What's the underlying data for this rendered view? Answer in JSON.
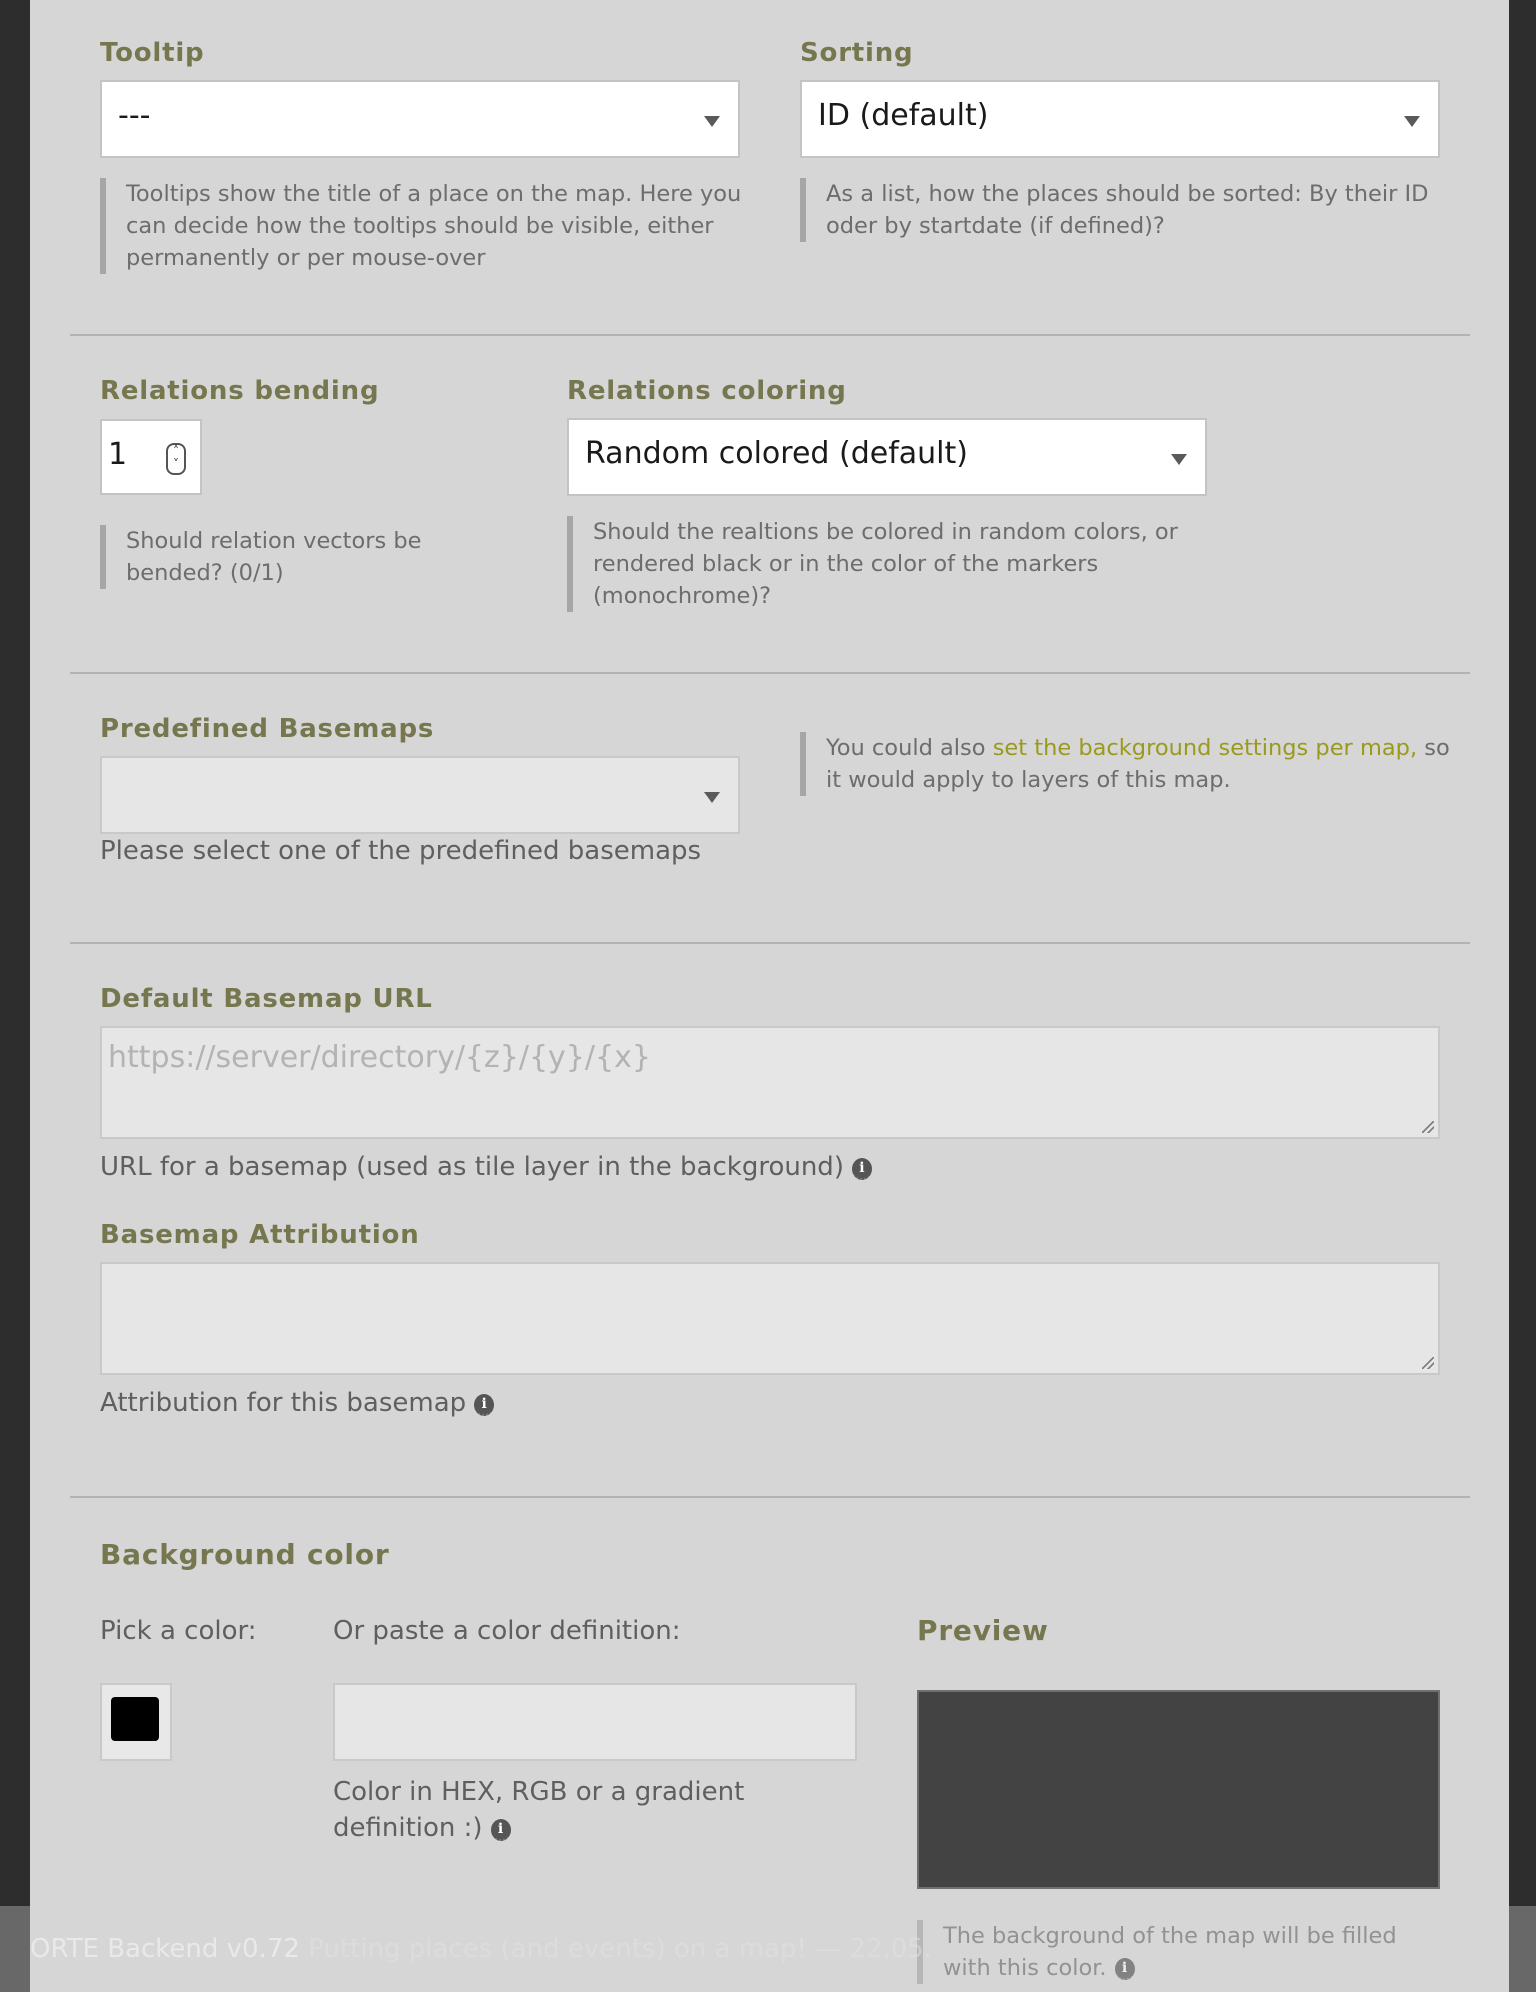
{
  "tooltip": {
    "label": "Tooltip",
    "value": "---",
    "help": "Tooltips show the title of a place on the map. Here you can decide how the tooltips should be visible, either permanently or per mouse-over"
  },
  "sorting": {
    "label": "Sorting",
    "value": "ID (default)",
    "help": "As a list, how the places should be sorted: By their ID oder by startdate (if defined)?"
  },
  "relations_bending": {
    "label": "Relations bending",
    "value": "1",
    "help": "Should relation vectors be bended? (0/1)"
  },
  "relations_coloring": {
    "label": "Relations coloring",
    "value": "Random colored (default)",
    "help": "Should the realtions be colored in random colors, or rendered black or in the color of the markers (monochrome)?"
  },
  "predefined_basemaps": {
    "label": "Predefined Basemaps",
    "value": "",
    "sub": "Please select one of the predefined basemaps",
    "help_pre": "You could also ",
    "help_link": "set the background settings per map,",
    "help_post": " so it would apply to layers of this map."
  },
  "default_basemap_url": {
    "label": "Default Basemap URL",
    "placeholder": "https://server/directory/{z}/{y}/{x}",
    "sub": "URL for a basemap (used as tile layer in the background)"
  },
  "basemap_attribution": {
    "label": "Basemap Attribution",
    "sub": "Attribution for this basemap"
  },
  "background_color": {
    "label": "Background color",
    "pick_label": "Pick a color:",
    "paste_label": "Or paste a color definition:",
    "paste_sub": "Color in HEX, RGB or a gradient definition :)",
    "picked_color": "#000000",
    "preview_label": "Preview",
    "preview_color": "#434343",
    "preview_help": "The background of the map will be filled with this color."
  },
  "footer": {
    "app": "ORTE Backend v0.72",
    "tagline": "Putting places (and events) on a map! — 22.05."
  },
  "icons": {
    "info": "info-icon",
    "caret": "chevron-down-icon"
  }
}
